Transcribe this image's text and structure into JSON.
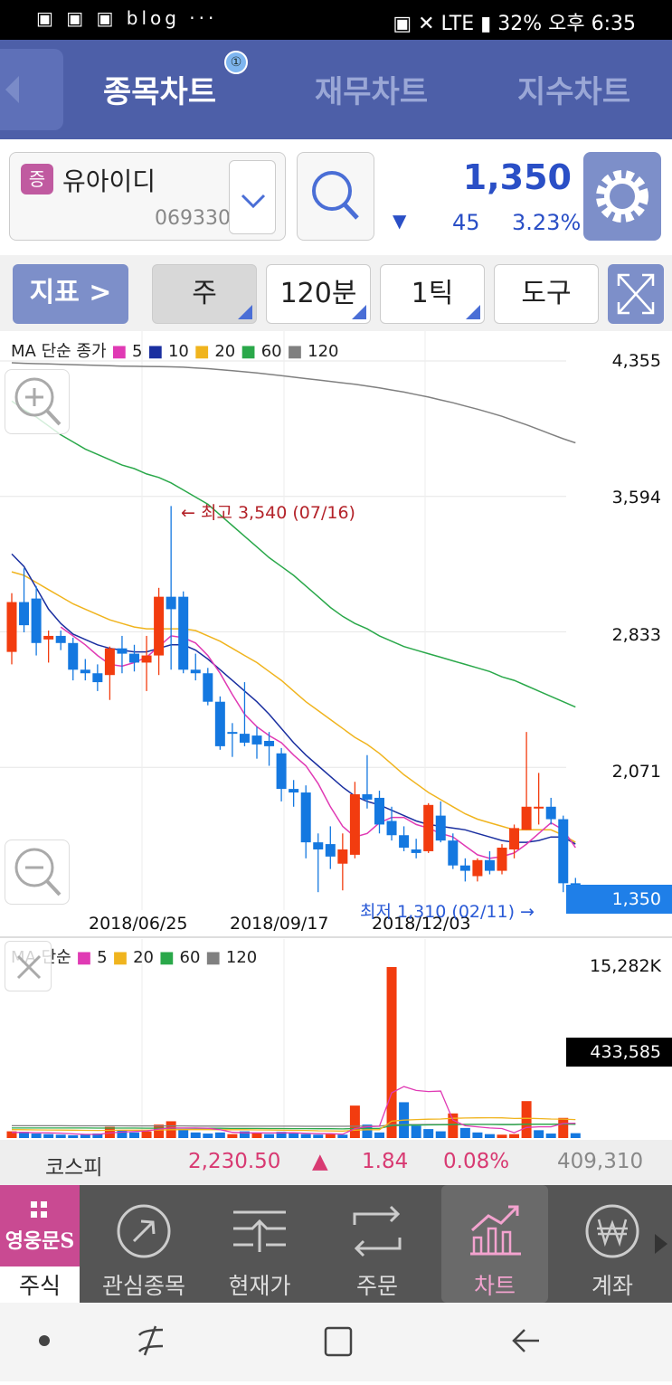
{
  "status_bar": {
    "left_icons": "blog ···",
    "right_text": "32% 오후 6:35",
    "network": "LTE"
  },
  "top_nav": {
    "tabs": [
      "종목차트",
      "재무차트",
      "지수차트"
    ],
    "badge": "①"
  },
  "stock": {
    "tag": "증",
    "name": "유아이디",
    "code": "069330",
    "price": "1,350",
    "direction_icon": "▼",
    "change": "45",
    "change_pct": "3.23%"
  },
  "toolbar": {
    "indicator_label": "지표 >",
    "period_label": "주",
    "interval_label": "120분",
    "tick_label": "1틱",
    "tools_label": "도구"
  },
  "chart_data": [
    {
      "type": "candlestick",
      "legend": {
        "prefix": "MA 단순 종가",
        "entries": [
          "5",
          "10",
          "20",
          "60",
          "120"
        ]
      },
      "colors": {
        "up": "#f23c0f",
        "down": "#1478e0",
        "ma5": "#e03ab4",
        "ma10": "#1a2fa0",
        "ma20": "#f0b41e",
        "ma60": "#2aa84a",
        "ma120": "#808080"
      },
      "y_ticks": [
        "4,355",
        "3,594",
        "2,833",
        "2,071"
      ],
      "ylim": [
        1310,
        4355
      ],
      "x_ticks": [
        "2018/06/25",
        "2018/09/17",
        "2018/12/03"
      ],
      "current_price_label": "1,350",
      "high_annotation": "← 최고 3,540 (07/16)",
      "low_annotation": "최저 1,310 (02/11) →",
      "candles": [
        [
          2720,
          3050,
          2650,
          3000
        ],
        [
          3000,
          3190,
          2830,
          2870
        ],
        [
          3020,
          3090,
          2700,
          2770
        ],
        [
          2790,
          2840,
          2660,
          2810
        ],
        [
          2810,
          2840,
          2730,
          2770
        ],
        [
          2770,
          2800,
          2560,
          2620
        ],
        [
          2620,
          2680,
          2560,
          2600
        ],
        [
          2600,
          2650,
          2500,
          2550
        ],
        [
          2590,
          2750,
          2450,
          2740
        ],
        [
          2740,
          2810,
          2600,
          2710
        ],
        [
          2710,
          2760,
          2610,
          2660
        ],
        [
          2660,
          2810,
          2500,
          2700
        ],
        [
          2700,
          3080,
          2590,
          3030
        ],
        [
          3030,
          3540,
          2620,
          2960
        ],
        [
          3030,
          3060,
          2600,
          2620
        ],
        [
          2620,
          2710,
          2560,
          2600
        ],
        [
          2600,
          2630,
          2420,
          2440
        ],
        [
          2440,
          2470,
          2170,
          2190
        ],
        [
          2270,
          2320,
          2130,
          2260
        ],
        [
          2260,
          2550,
          2190,
          2210
        ],
        [
          2250,
          2300,
          2120,
          2200
        ],
        [
          2220,
          2270,
          2080,
          2190
        ],
        [
          2150,
          2180,
          1880,
          1950
        ],
        [
          1950,
          2000,
          1850,
          1930
        ],
        [
          1930,
          1970,
          1560,
          1650
        ],
        [
          1650,
          1700,
          1370,
          1610
        ],
        [
          1640,
          1740,
          1500,
          1570
        ],
        [
          1530,
          1700,
          1380,
          1610
        ],
        [
          1580,
          1990,
          1560,
          1920
        ],
        [
          1920,
          2140,
          1840,
          1890
        ],
        [
          1900,
          1940,
          1700,
          1750
        ],
        [
          1770,
          1850,
          1660,
          1690
        ],
        [
          1690,
          1740,
          1600,
          1620
        ],
        [
          1610,
          1670,
          1560,
          1590
        ],
        [
          1600,
          1870,
          1590,
          1860
        ],
        [
          1800,
          1880,
          1650,
          1660
        ],
        [
          1660,
          1700,
          1500,
          1520
        ],
        [
          1520,
          1560,
          1430,
          1490
        ],
        [
          1460,
          1560,
          1430,
          1550
        ],
        [
          1550,
          1600,
          1470,
          1490
        ],
        [
          1490,
          1640,
          1470,
          1620
        ],
        [
          1610,
          1750,
          1560,
          1730
        ],
        [
          1720,
          2270,
          1720,
          1850
        ],
        [
          1850,
          2040,
          1750,
          1850
        ],
        [
          1850,
          1900,
          1750,
          1780
        ],
        [
          1780,
          1800,
          1370,
          1420
        ],
        [
          1420,
          1450,
          1310,
          1350
        ]
      ],
      "ma": {
        "ma5": [
          null,
          null,
          null,
          null,
          2860,
          2810,
          2760,
          2700,
          2650,
          2640,
          2660,
          2690,
          2750,
          2810,
          2800,
          2770,
          2700,
          2600,
          2480,
          2370,
          2300,
          2250,
          2210,
          2140,
          2080,
          1980,
          1850,
          1740,
          1680,
          1700,
          1760,
          1790,
          1790,
          1750,
          1730,
          1700,
          1680,
          1630,
          1580,
          1560,
          1570,
          1590,
          1640,
          1700,
          1760,
          1720,
          1620
        ],
        "ma10": [
          3270,
          3200,
          3080,
          2960,
          2880,
          2820,
          2790,
          2760,
          2740,
          2730,
          2720,
          2720,
          2740,
          2760,
          2760,
          2730,
          2680,
          2620,
          2560,
          2500,
          2440,
          2370,
          2290,
          2210,
          2140,
          2080,
          2020,
          1960,
          1910,
          1880,
          1860,
          1830,
          1800,
          1770,
          1750,
          1740,
          1730,
          1720,
          1700,
          1680,
          1660,
          1650,
          1650,
          1660,
          1680,
          1680,
          1640
        ],
        "ma20": [
          3170,
          3150,
          3110,
          3070,
          3030,
          2990,
          2960,
          2930,
          2900,
          2880,
          2860,
          2850,
          2850,
          2850,
          2850,
          2840,
          2810,
          2780,
          2740,
          2700,
          2660,
          2610,
          2560,
          2500,
          2440,
          2390,
          2340,
          2290,
          2240,
          2200,
          2150,
          2090,
          2030,
          1980,
          1930,
          1890,
          1850,
          1810,
          1780,
          1760,
          1740,
          1720,
          1720,
          1720,
          1720,
          1690,
          1650
        ],
        "ma60": [
          4130,
          4080,
          4040,
          3990,
          3940,
          3900,
          3860,
          3830,
          3800,
          3770,
          3750,
          3720,
          3700,
          3670,
          3630,
          3590,
          3550,
          3490,
          3430,
          3370,
          3310,
          3250,
          3200,
          3150,
          3090,
          3030,
          2970,
          2920,
          2880,
          2850,
          2810,
          2780,
          2750,
          2730,
          2710,
          2690,
          2670,
          2650,
          2630,
          2610,
          2580,
          2560,
          2530,
          2500,
          2470,
          2440,
          2410
        ],
        "ma120": [
          4345,
          4342,
          4340,
          4338,
          4336,
          4334,
          4332,
          4330,
          4328,
          4326,
          4325,
          4324,
          4323,
          4322,
          4320,
          4316,
          4312,
          4306,
          4300,
          4294,
          4288,
          4280,
          4272,
          4264,
          4256,
          4248,
          4240,
          4232,
          4224,
          4214,
          4204,
          4192,
          4180,
          4166,
          4152,
          4136,
          4120,
          4102,
          4084,
          4064,
          4044,
          4020,
          3996,
          3970,
          3944,
          3918,
          3895
        ]
      }
    },
    {
      "type": "bar",
      "legend": {
        "prefix": "MA 단순",
        "entries": [
          "5",
          "20",
          "60",
          "120"
        ]
      },
      "y_ticks": [
        "15,282K"
      ],
      "current_volume_label": "433,585",
      "ylim": [
        0,
        15282000
      ],
      "values": [
        600000,
        550000,
        400000,
        350000,
        300000,
        250000,
        300000,
        400000,
        1000000,
        700000,
        500000,
        600000,
        1200000,
        1500000,
        800000,
        500000,
        400000,
        500000,
        350000,
        600000,
        450000,
        350000,
        550000,
        400000,
        350000,
        300000,
        350000,
        300000,
        2900000,
        1200000,
        500000,
        15282000,
        3200000,
        1100000,
        800000,
        600000,
        2200000,
        900000,
        500000,
        350000,
        300000,
        350000,
        3300000,
        700000,
        400000,
        1800000,
        433585
      ],
      "up_flags": [
        1,
        0,
        0,
        0,
        0,
        0,
        0,
        0,
        1,
        0,
        0,
        1,
        1,
        1,
        0,
        0,
        0,
        0,
        1,
        0,
        1,
        0,
        0,
        0,
        0,
        0,
        1,
        0,
        1,
        0,
        0,
        1,
        0,
        0,
        0,
        0,
        1,
        0,
        0,
        0,
        1,
        1,
        1,
        0,
        0,
        1,
        0
      ],
      "ma5": [
        500000,
        500000,
        480000,
        460000,
        440000,
        370000,
        320000,
        320000,
        450000,
        530000,
        580000,
        640000,
        800000,
        900000,
        900000,
        900000,
        880000,
        740000,
        510000,
        470000,
        460000,
        450000,
        460000,
        470000,
        420000,
        390000,
        390000,
        340000,
        840000,
        1010000,
        1050000,
        4040000,
        4600000,
        4250000,
        4160000,
        4200000,
        1600000,
        1100000,
        1000000,
        900000,
        850000,
        480000,
        950000,
        1000000,
        1000000,
        1300000,
        1330000
      ],
      "ma20": [
        750000,
        740000,
        730000,
        720000,
        710000,
        700000,
        690000,
        680000,
        690000,
        700000,
        700000,
        700000,
        720000,
        740000,
        750000,
        750000,
        750000,
        740000,
        740000,
        740000,
        730000,
        720000,
        700000,
        690000,
        680000,
        650000,
        640000,
        620000,
        700000,
        740000,
        740000,
        1500000,
        1600000,
        1650000,
        1680000,
        1700000,
        1760000,
        1790000,
        1800000,
        1810000,
        1800000,
        1750000,
        1760000,
        1740000,
        1700000,
        1690000,
        1650000
      ],
      "ma60": [
        900000,
        900000,
        900000,
        900000,
        900000,
        900000,
        900000,
        890000,
        890000,
        890000,
        890000,
        880000,
        880000,
        880000,
        880000,
        870000,
        870000,
        870000,
        860000,
        860000,
        860000,
        850000,
        850000,
        840000,
        840000,
        830000,
        830000,
        820000,
        850000,
        860000,
        860000,
        1100000,
        1150000,
        1160000,
        1170000,
        1180000,
        1200000,
        1210000,
        1210000,
        1210000,
        1200000,
        1200000,
        1240000,
        1240000,
        1230000,
        1250000,
        1230000
      ],
      "ma120": [
        1100000,
        1100000,
        1100000,
        1100000,
        1100000,
        1090000,
        1090000,
        1090000,
        1090000,
        1090000,
        1080000,
        1080000,
        1080000,
        1080000,
        1080000,
        1070000,
        1070000,
        1070000,
        1070000,
        1070000,
        1060000,
        1060000,
        1060000,
        1060000,
        1050000,
        1050000,
        1050000,
        1050000,
        1060000,
        1060000,
        1060000,
        1180000,
        1200000,
        1200000,
        1210000,
        1210000,
        1220000,
        1220000,
        1220000,
        1220000,
        1220000,
        1220000,
        1240000,
        1240000,
        1240000,
        1250000,
        1250000
      ]
    }
  ],
  "kospi": {
    "name": "코스피",
    "value": "2,230.50",
    "arrow": "▲",
    "change": "1.84",
    "pct": "0.08%",
    "volume": "409,310"
  },
  "bottom_nav": {
    "brand": "영웅문S",
    "items": [
      "주식",
      "관심종목",
      "현재가",
      "주문",
      "차트",
      "계좌"
    ]
  }
}
